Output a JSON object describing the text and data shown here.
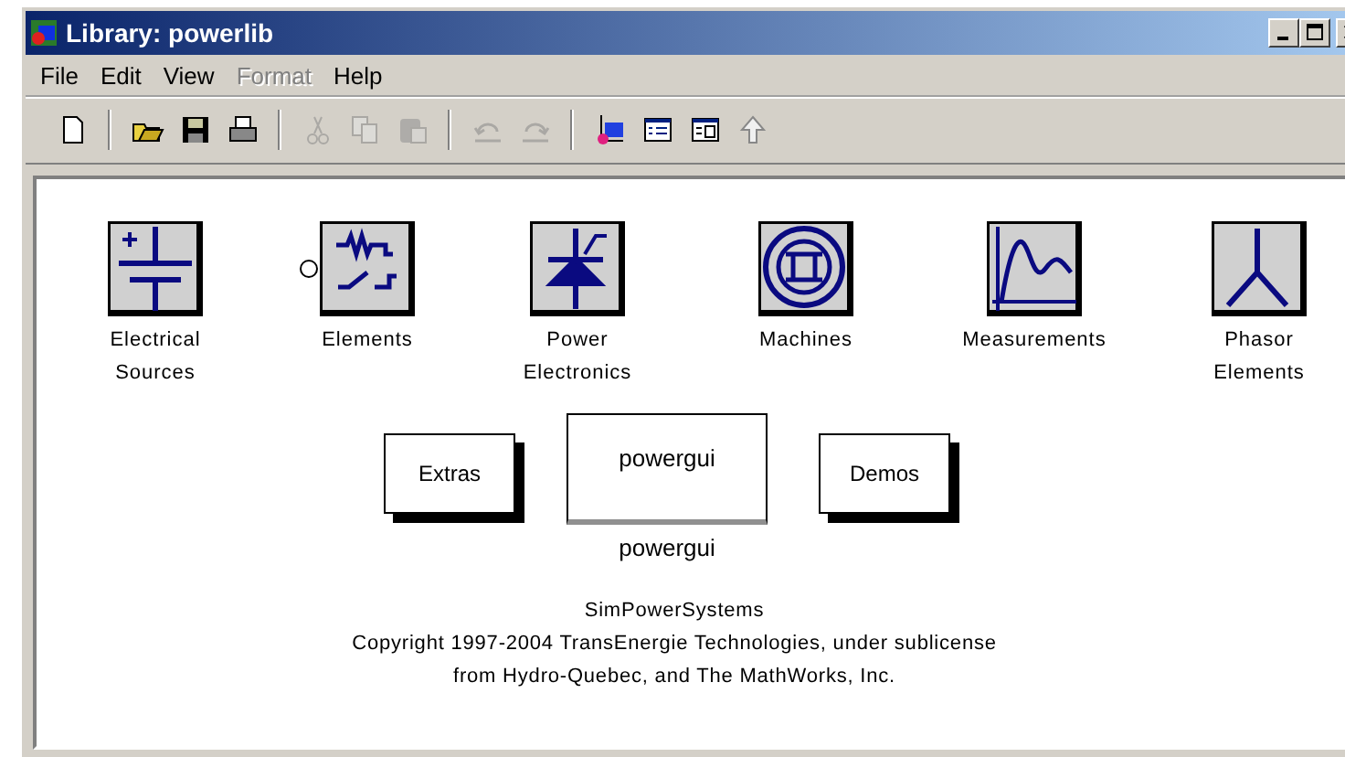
{
  "window": {
    "title": "Library: powerlib"
  },
  "menu": [
    {
      "label": "File",
      "disabled": false
    },
    {
      "label": "Edit",
      "disabled": false
    },
    {
      "label": "View",
      "disabled": false
    },
    {
      "label": "Format",
      "disabled": true
    },
    {
      "label": "Help",
      "disabled": false
    }
  ],
  "toolbar": [
    [
      {
        "kind": "new",
        "disabled": false
      }
    ],
    [
      {
        "kind": "open",
        "disabled": false
      },
      {
        "kind": "save",
        "disabled": false
      },
      {
        "kind": "print",
        "disabled": false
      }
    ],
    [
      {
        "kind": "cut",
        "disabled": true
      },
      {
        "kind": "copy",
        "disabled": true
      },
      {
        "kind": "paste",
        "disabled": true
      }
    ],
    [
      {
        "kind": "undo",
        "disabled": true
      },
      {
        "kind": "redo",
        "disabled": true
      }
    ],
    [
      {
        "kind": "browser",
        "disabled": false
      },
      {
        "kind": "list",
        "disabled": false
      },
      {
        "kind": "properties",
        "disabled": false
      },
      {
        "kind": "up",
        "disabled": false
      }
    ]
  ],
  "blocks": [
    {
      "kind": "dc-source",
      "label": [
        "Electrical",
        "Sources"
      ]
    },
    {
      "kind": "rlc",
      "label": [
        "Elements"
      ]
    },
    {
      "kind": "thyristor",
      "label": [
        "Power",
        "Electronics"
      ]
    },
    {
      "kind": "machine",
      "label": [
        "Machines"
      ]
    },
    {
      "kind": "scope",
      "label": [
        "Measurements"
      ]
    },
    {
      "kind": "phasor",
      "label": [
        "Phasor",
        "Elements"
      ]
    }
  ],
  "subsystems": [
    {
      "kind": "masked",
      "text": "Extras"
    },
    {
      "kind": "gui",
      "text": "powergui",
      "caption": "powergui"
    },
    {
      "kind": "masked",
      "text": "Demos"
    }
  ],
  "footer": [
    "SimPowerSystems",
    "Copyright  1997-2004 TransEnergie Technologies, under sublicense",
    "from Hydro-Quebec, and The MathWorks, Inc."
  ]
}
